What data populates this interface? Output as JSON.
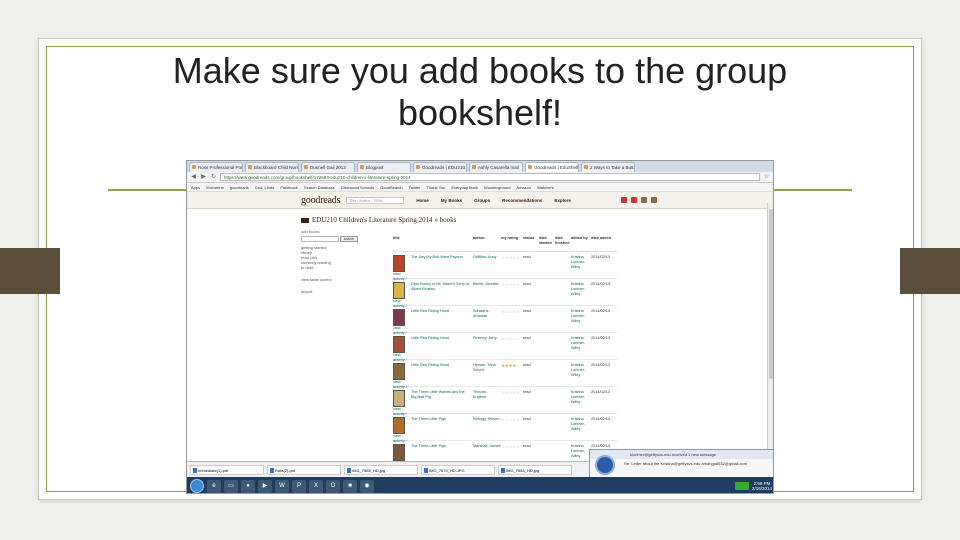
{
  "slide": {
    "title_line1": "Make sure you add books to the group",
    "title_line2": "bookshelf!"
  },
  "browser": {
    "tabs": [
      "Ross Professional Portfolio",
      "Blackboard Child Nurse",
      "Dunnell Gail 2013",
      "Blogpost",
      "Goodreads | EDU210",
      "Ashly Casarella mail",
      "Goodreads | EduShelf",
      "2 Ways to Take a Butter"
    ],
    "url": "https://www.goodreads.com/group/bookshelf/172693-edu210-children-s-literature-spring-2014",
    "bookmarks": [
      "Apps",
      "Wolverine",
      "goodreads",
      "Grid, Linda",
      "Facebook",
      "Search Database",
      "Glenwood Schools",
      "GoodSearch",
      "Twitter",
      "Thank You",
      "Everyday Math",
      "Wunderground",
      "Amazon",
      "Watchers"
    ]
  },
  "goodreads": {
    "logo": "goodreads",
    "search_placeholder": "Title / Author / ISBN",
    "nav_home": "Home",
    "nav_mybooks": "My Books",
    "nav_groups": "Groups",
    "nav_recommendations": "Recommendations",
    "nav_explore": "Explore",
    "shelf_title": "EDU210 Children's Literature Spring 2014 » books",
    "sidebar": {
      "add_books": "add books",
      "search_button": "search",
      "links": [
        "getting started",
        "library",
        "read (all)",
        "currently reading",
        "to read"
      ],
      "view": "view table covers",
      "import": "Import"
    },
    "headers": [
      "title",
      "author",
      "my rating",
      "status",
      "date started",
      "date finished",
      "added by",
      "date added",
      ""
    ],
    "rows": [
      {
        "title": "The Day My Butt Went Psycho",
        "author": "Griffiths, Andy",
        "rating": "☆☆☆☆☆",
        "status": "read",
        "added_by": "Kristina Lorimer-Wiley",
        "date_added": "2014/02/13",
        "actions": "view activity / edit"
      },
      {
        "title": "Dear Bunny of Mr. Albert's Story of Albert Einstein",
        "author": "Berne, Jennifer",
        "rating": "☆☆☆☆☆",
        "status": "read",
        "added_by": "Kristina Lorimer-Wiley",
        "date_added": "2014/02/13",
        "actions": "view activity / edit"
      },
      {
        "title": "Little Red Riding Hood",
        "author": "Schwartz, Amanda",
        "rating": "☆☆☆☆☆",
        "status": "read",
        "added_by": "Kristina Lorimer-Wiley",
        "date_added": "2014/02/13",
        "actions": "view activity / edit"
      },
      {
        "title": "Little Red Riding Hood",
        "author": "Pinkney, Jerry",
        "rating": "☆☆☆☆☆",
        "status": "read",
        "added_by": "Kristina Lorimer-Wiley",
        "date_added": "2014/02/13",
        "actions": "view activity / edit"
      },
      {
        "title": "Little Red Riding Hood",
        "author": "Hyman, Trina Schart",
        "rating": "★★★★☆",
        "status": "read",
        "added_by": "Kristina Lorimer-Wiley",
        "date_added": "2014/02/13",
        "actions": "view activity / edit"
      },
      {
        "title": "The Three Little Wolves and the Big Bad Pig",
        "author": "Trivizas, Eugene",
        "rating": "☆☆☆☆☆",
        "status": "read",
        "added_by": "Kristina Lorimer-Wiley",
        "date_added": "2014/02/13",
        "actions": "view activity / edit"
      },
      {
        "title": "The Three Little Pigs",
        "author": "Kellogg, Steven",
        "rating": "☆☆☆☆☆",
        "status": "read",
        "added_by": "Kristina Lorimer-Wiley",
        "date_added": "2014/02/13",
        "actions": "view activity / edit"
      },
      {
        "title": "The Three Little Pigs",
        "author": "Marshall, James",
        "rating": "☆☆☆☆☆",
        "status": "read",
        "added_by": "Kristina Lorimer-Wiley",
        "date_added": "2014/02/13",
        "actions": "view activity / edit"
      }
    ]
  },
  "notification": {
    "title": "klorimer@gettysvs.edu received 1 new message",
    "content": "Re: Letter about the Kristina@gettysvs.edu  amanga8632@gmail.com"
  },
  "downloads": [
    "Immediate(1).pdf",
    "Ruta(2).pdf",
    "IMG_7568_HD.jpg",
    "IMG_7579_HD.JPG",
    "IMG_7584_HD.jpg"
  ],
  "taskbar": {
    "clock_time": "2:59 PM",
    "clock_date": "2/16/2014"
  },
  "colors": {
    "frame_green": "#8ea04a",
    "side_bar_brown": "#5b4f3c",
    "goodreads_header": "#f4f1ea",
    "goodreads_link": "#00635d"
  }
}
